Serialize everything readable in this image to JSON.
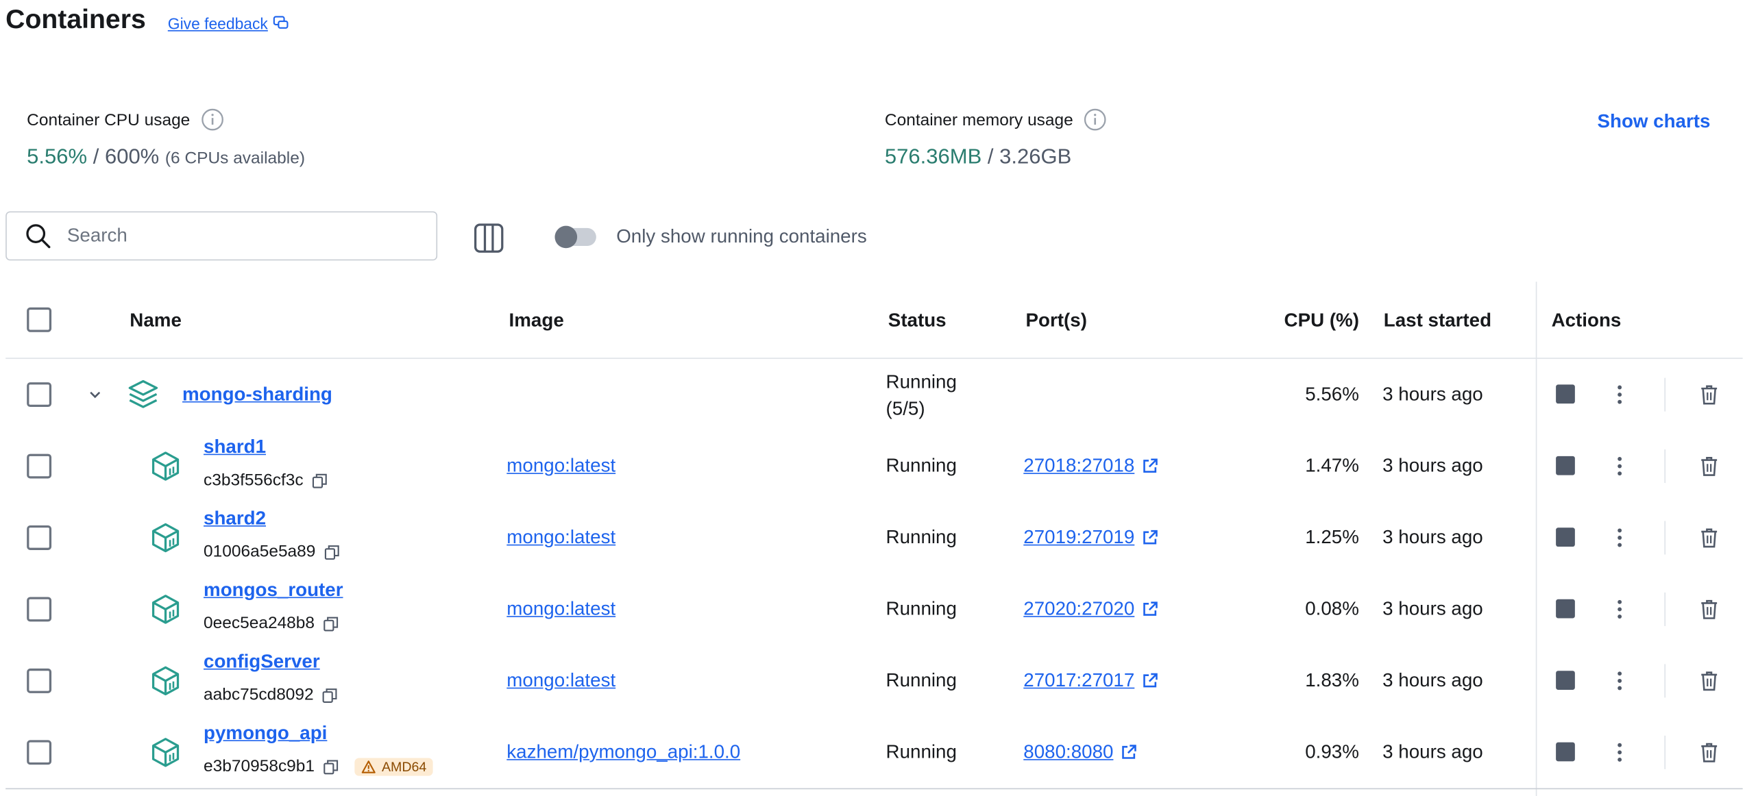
{
  "header": {
    "title": "Containers",
    "feedback_label": "Give feedback"
  },
  "stats": {
    "cpu": {
      "label": "Container CPU usage",
      "value": "5.56%",
      "sep": " / ",
      "total": "600%",
      "note": "(6 CPUs available)"
    },
    "memory": {
      "label": "Container memory usage",
      "value": "576.36MB",
      "sep": " / ",
      "total": "3.26GB"
    },
    "show_charts_label": "Show charts"
  },
  "toolbar": {
    "search_placeholder": "Search",
    "toggle_label": "Only show running containers"
  },
  "table": {
    "headers": {
      "name": "Name",
      "image": "Image",
      "status": "Status",
      "ports": "Port(s)",
      "cpu": "CPU (%)",
      "last_started": "Last started",
      "actions": "Actions"
    },
    "group": {
      "name": "mongo-sharding",
      "status_line1": "Running",
      "status_line2": "(5/5)",
      "cpu": "5.56%",
      "last_started": "3 hours ago"
    },
    "rows": [
      {
        "name": "shard1",
        "id": "c3b3f556cf3c",
        "image": "mongo:latest",
        "status": "Running",
        "port": "27018:27018",
        "cpu": "1.47%",
        "last_started": "3 hours ago"
      },
      {
        "name": "shard2",
        "id": "01006a5e5a89",
        "image": "mongo:latest",
        "status": "Running",
        "port": "27019:27019",
        "cpu": "1.25%",
        "last_started": "3 hours ago"
      },
      {
        "name": "mongos_router",
        "id": "0eec5ea248b8",
        "image": "mongo:latest",
        "status": "Running",
        "port": "27020:27020",
        "cpu": "0.08%",
        "last_started": "3 hours ago"
      },
      {
        "name": "configServer",
        "id": "aabc75cd8092",
        "image": "mongo:latest",
        "status": "Running",
        "port": "27017:27017",
        "cpu": "1.83%",
        "last_started": "3 hours ago"
      },
      {
        "name": "pymongo_api",
        "id": "e3b70958c9b1",
        "badge": "AMD64",
        "image": "kazhem/pymongo_api:1.0.0",
        "status": "Running",
        "port": "8080:8080",
        "cpu": "0.93%",
        "last_started": "3 hours ago"
      }
    ]
  },
  "colors": {
    "accent": "#1d63ed",
    "green": "#2a7d6f",
    "stop": "#505968"
  }
}
